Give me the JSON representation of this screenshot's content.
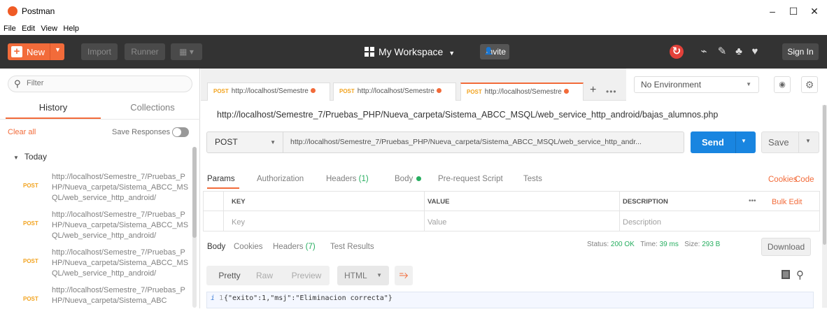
{
  "window": {
    "title": "Postman",
    "minimize": "–",
    "maximize": "☐",
    "close": "✕"
  },
  "menu": [
    "File",
    "Edit",
    "View",
    "Help"
  ],
  "toolbar": {
    "new_label": "New",
    "import_label": "Import",
    "runner_label": "Runner",
    "workspace_label": "My Workspace",
    "invite_label": "Invite",
    "signin_label": "Sign In"
  },
  "sidebar": {
    "filter_placeholder": "Filter",
    "tab_history": "History",
    "tab_collections": "Collections",
    "clear_all": "Clear all",
    "save_responses": "Save Responses",
    "group_label": "Today",
    "items": [
      {
        "method": "POST",
        "url": "http://localhost/Semestre_7/Pruebas_PHP/Nueva_carpeta/Sistema_ABCC_MSQL/web_service_http_android/"
      },
      {
        "method": "POST",
        "url": "http://localhost/Semestre_7/Pruebas_PHP/Nueva_carpeta/Sistema_ABCC_MSQL/web_service_http_android/"
      },
      {
        "method": "POST",
        "url": "http://localhost/Semestre_7/Pruebas_PHP/Nueva_carpeta/Sistema_ABCC_MSQL/web_service_http_android/"
      },
      {
        "method": "POST",
        "url": "http://localhost/Semestre_7/Pruebas_PHP/Nueva_carpeta/Sistema_ABC"
      }
    ]
  },
  "request_tabs": [
    {
      "method": "POST",
      "label": "http://localhost/Semestre"
    },
    {
      "method": "POST",
      "label": "http://localhost/Semestre"
    },
    {
      "method": "POST",
      "label": "http://localhost/Semestre"
    }
  ],
  "environment": {
    "selected": "No Environment"
  },
  "request": {
    "title_url": "http://localhost/Semestre_7/Pruebas_PHP/Nueva_carpeta/Sistema_ABCC_MSQL/web_service_http_android/bajas_alumnos.php",
    "method": "POST",
    "url": "http://localhost/Semestre_7/Pruebas_PHP/Nueva_carpeta/Sistema_ABCC_MSQL/web_service_http_andr...",
    "send_label": "Send",
    "save_label": "Save"
  },
  "param_tabs": {
    "params": "Params",
    "authorization": "Authorization",
    "headers": "Headers",
    "headers_count": "(1)",
    "body": "Body",
    "prerequest": "Pre-request Script",
    "tests": "Tests",
    "cookies": "Cookies",
    "code": "Code"
  },
  "params_table": {
    "headers": [
      "KEY",
      "VALUE",
      "DESCRIPTION"
    ],
    "more": "•••",
    "bulk_edit": "Bulk Edit",
    "placeholders": [
      "Key",
      "Value",
      "Description"
    ]
  },
  "response_tabs": {
    "body": "Body",
    "cookies": "Cookies",
    "headers": "Headers",
    "headers_count": "(7)",
    "test_results": "Test Results"
  },
  "response_status": {
    "status_label": "Status:",
    "status_value": "200 OK",
    "time_label": "Time:",
    "time_value": "39 ms",
    "size_label": "Size:",
    "size_value": "293 B",
    "download_label": "Download"
  },
  "viewer": {
    "pretty": "Pretty",
    "raw": "Raw",
    "preview": "Preview",
    "format": "HTML",
    "line_marker": "i",
    "line_number": "1",
    "line_text": "{\"exito\":1,\"msj\":\"Eliminacion correcta\"}"
  },
  "colors": {
    "accent": "#f26b3a",
    "send": "#1985e0",
    "post": "#f2a31f",
    "ok": "#27ae60",
    "toolbar": "#333333"
  }
}
